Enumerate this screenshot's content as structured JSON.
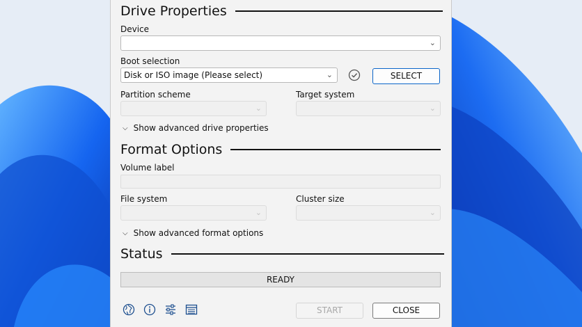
{
  "colors": {
    "accent": "#0a64c8",
    "window_bg": "#f3f3f3",
    "wallpaper_blue": "#1a5fe0"
  },
  "drive_properties": {
    "heading": "Drive Properties",
    "device_label": "Device",
    "device_value": "",
    "boot_selection_label": "Boot selection",
    "boot_selection_value": "Disk or ISO image (Please select)",
    "verify_icon": "check-circle-icon",
    "select_button": "SELECT",
    "partition_scheme_label": "Partition scheme",
    "partition_scheme_value": "",
    "target_system_label": "Target system",
    "target_system_value": "",
    "advanced_toggle": "Show advanced drive properties"
  },
  "format_options": {
    "heading": "Format Options",
    "volume_label_label": "Volume label",
    "volume_label_value": "",
    "file_system_label": "File system",
    "file_system_value": "",
    "cluster_size_label": "Cluster size",
    "cluster_size_value": "",
    "advanced_toggle": "Show advanced format options"
  },
  "status": {
    "heading": "Status",
    "text": "READY"
  },
  "footer": {
    "icons": [
      "globe-icon",
      "info-icon",
      "settings-sliders-icon",
      "log-icon"
    ],
    "start_button": "START",
    "close_button": "CLOSE"
  }
}
